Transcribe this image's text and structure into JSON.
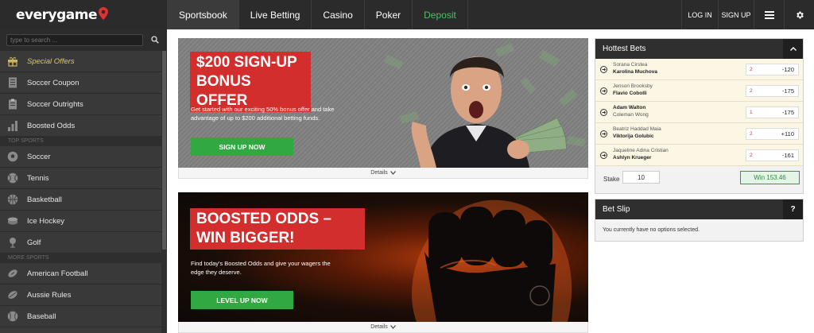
{
  "brand": {
    "name": "everygame"
  },
  "nav": [
    {
      "label": "Sportsbook",
      "active": true
    },
    {
      "label": "Live Betting",
      "active": false
    },
    {
      "label": "Casino",
      "active": false
    },
    {
      "label": "Poker",
      "active": false
    },
    {
      "label": "Deposit",
      "active": false
    }
  ],
  "header": {
    "login": "LOG IN",
    "signup": "SIGN UP",
    "menu_icon": "hamburger-icon",
    "settings_icon": "gear-icon"
  },
  "sidebar": {
    "search_placeholder": "type to search ...",
    "items": [
      {
        "label": "Special Offers",
        "icon": "gift-icon"
      },
      {
        "label": "Soccer Coupon",
        "icon": "coupon-icon"
      },
      {
        "label": "Soccer Outrights",
        "icon": "clipboard-icon"
      },
      {
        "label": "Boosted Odds",
        "icon": "bar-chart-icon"
      }
    ],
    "top_sports_heading": "TOP SPORTS",
    "top_sports": [
      {
        "label": "Soccer",
        "icon": "soccer-ball-icon"
      },
      {
        "label": "Tennis",
        "icon": "tennis-ball-icon"
      },
      {
        "label": "Basketball",
        "icon": "basketball-icon"
      },
      {
        "label": "Ice Hockey",
        "icon": "hockey-puck-icon"
      },
      {
        "label": "Golf",
        "icon": "golf-icon"
      }
    ],
    "more_sports_heading": "MORE SPORTS",
    "more_sports": [
      {
        "label": "American Football",
        "icon": "american-football-icon"
      },
      {
        "label": "Aussie Rules",
        "icon": "aussie-rules-ball-icon"
      },
      {
        "label": "Baseball",
        "icon": "baseball-icon"
      }
    ]
  },
  "banners": [
    {
      "title_line1": "$200 SIGN-UP",
      "title_line2": "BONUS OFFER",
      "description": "Get started with our exciting 50% bonus offer and take advantage of up to $200 additional betting funds.",
      "cta": "SIGN UP NOW",
      "details": "Details"
    },
    {
      "title_line1": "BOOSTED ODDS –",
      "title_line2": "WIN BIGGER!",
      "description": "Find today's Boosted Odds and give your wagers the edge they deserve.",
      "cta": "LEVEL UP NOW",
      "details": "Details"
    }
  ],
  "hottest_bets": {
    "title": "Hottest Bets",
    "rows": [
      {
        "player1": "Sorana Cirstea",
        "player2": "Karolina Muchova",
        "bold": 2,
        "pick": "2",
        "price": "-120"
      },
      {
        "player1": "Jenson Brooksby",
        "player2": "Flavio Cobolli",
        "bold": 2,
        "pick": "2",
        "price": "-175"
      },
      {
        "player1": "Adam Walton",
        "player2": "Coleman Wong",
        "bold": 1,
        "pick": "1",
        "price": "-175"
      },
      {
        "player1": "Beatriz Haddad Maia",
        "player2": "Viktorija Golubic",
        "bold": 2,
        "pick": "2",
        "price": "+110"
      },
      {
        "player1": "Jaqueline Adina Cristian",
        "player2": "Ashlyn Krueger",
        "bold": 2,
        "pick": "2",
        "price": "-161"
      }
    ],
    "stake_label": "Stake",
    "stake_value": "10",
    "win_label": "Win 153.46"
  },
  "bet_slip": {
    "title": "Bet Slip",
    "help": "?",
    "empty_message": "You currently have no options selected."
  },
  "colors": {
    "topbar": "#2b2b2b",
    "sidebar": "#393939",
    "accent_green": "#32a842",
    "accent_red": "#d22e2e",
    "deposit_green": "#4cc063"
  }
}
